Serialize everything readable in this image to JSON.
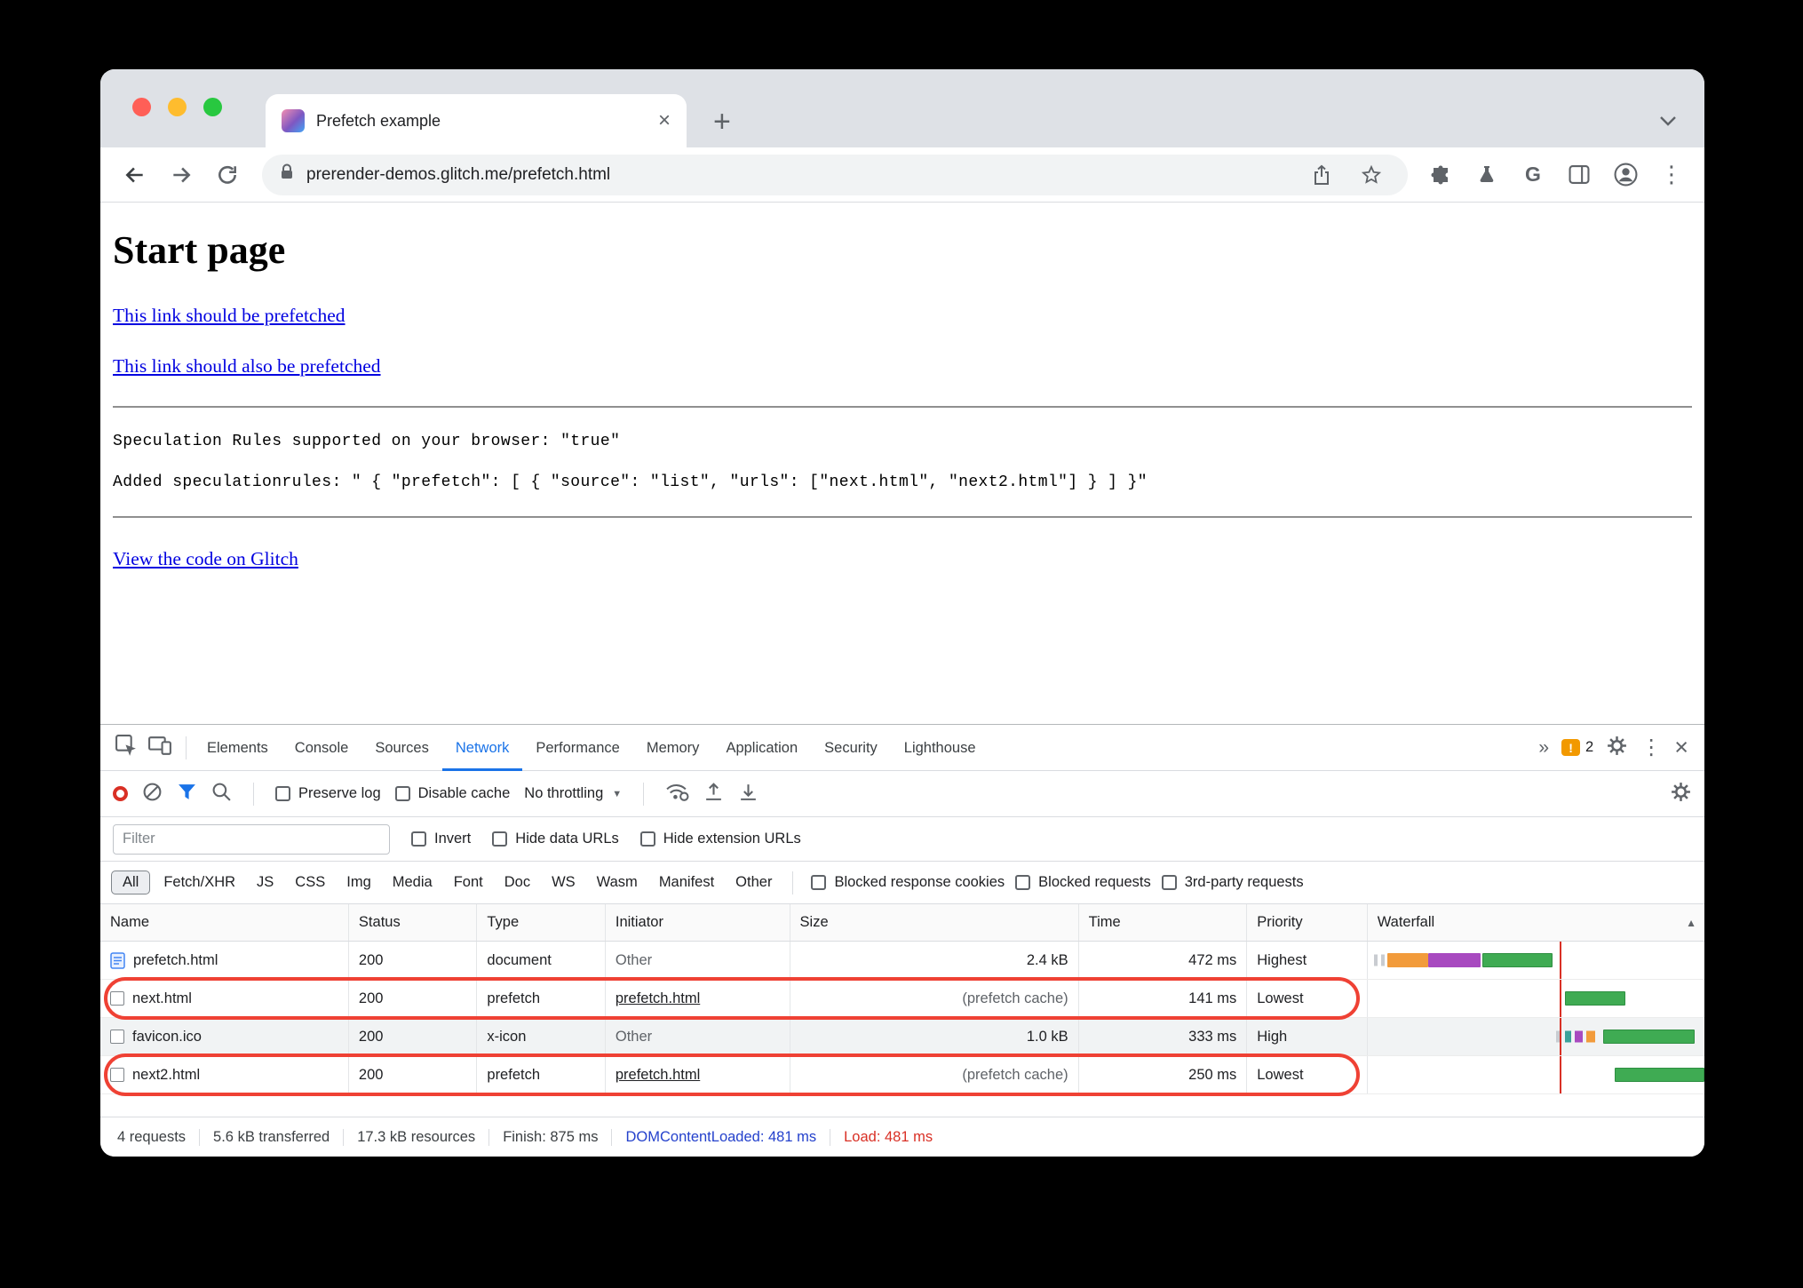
{
  "window": {
    "tab_title": "Prefetch example",
    "url": "prerender-demos.glitch.me/prefetch.html"
  },
  "page": {
    "heading": "Start page",
    "link1": "This link should be prefetched",
    "link2": "This link should also be prefetched",
    "code_line1": "Speculation Rules supported on your browser: \"true\"",
    "code_line2": "Added speculationrules: \" { \"prefetch\": [ { \"source\": \"list\", \"urls\": [\"next.html\", \"next2.html\"] } ] }\"",
    "glitch_link": "View the code on Glitch"
  },
  "devtools": {
    "tabs": [
      "Elements",
      "Console",
      "Sources",
      "Network",
      "Performance",
      "Memory",
      "Application",
      "Security",
      "Lighthouse"
    ],
    "selected_tab": "Network",
    "warning_count": "2",
    "toolbar": {
      "preserve_log": "Preserve log",
      "disable_cache": "Disable cache",
      "throttling": "No throttling"
    },
    "filter": {
      "placeholder": "Filter",
      "invert": "Invert",
      "hide_data_urls": "Hide data URLs",
      "hide_extension_urls": "Hide extension URLs",
      "types": [
        "All",
        "Fetch/XHR",
        "JS",
        "CSS",
        "Img",
        "Media",
        "Font",
        "Doc",
        "WS",
        "Wasm",
        "Manifest",
        "Other"
      ],
      "selected_type": "All",
      "blocked_cookies": "Blocked response cookies",
      "blocked_requests": "Blocked requests",
      "third_party": "3rd-party requests"
    },
    "table": {
      "columns": [
        "Name",
        "Status",
        "Type",
        "Initiator",
        "Size",
        "Time",
        "Priority",
        "Waterfall"
      ],
      "rows": [
        {
          "name": "prefetch.html",
          "status": "200",
          "type": "document",
          "initiator": "Other",
          "size": "2.4 kB",
          "time": "472 ms",
          "priority": "Highest"
        },
        {
          "name": "next.html",
          "status": "200",
          "type": "prefetch",
          "initiator": "prefetch.html",
          "size": "(prefetch cache)",
          "time": "141 ms",
          "priority": "Lowest"
        },
        {
          "name": "favicon.ico",
          "status": "200",
          "type": "x-icon",
          "initiator": "Other",
          "size": "1.0 kB",
          "time": "333 ms",
          "priority": "High"
        },
        {
          "name": "next2.html",
          "status": "200",
          "type": "prefetch",
          "initiator": "prefetch.html",
          "size": "(prefetch cache)",
          "time": "250 ms",
          "priority": "Lowest"
        }
      ]
    },
    "summary": {
      "requests": "4 requests",
      "transferred": "5.6 kB transferred",
      "resources": "17.3 kB resources",
      "finish": "Finish: 875 ms",
      "dcl": "DOMContentLoaded: 481 ms",
      "load": "Load: 481 ms"
    }
  },
  "colors": {
    "accent_blue": "#1a73e8",
    "highlight_red": "#ef4134",
    "load_red": "#d93025",
    "dcl_blue": "#2441cc",
    "waterfall_green": "#3fab53",
    "waterfall_green_dark": "#2f8f42",
    "waterfall_orange": "#f29b3b",
    "waterfall_purple": "#a84ac0",
    "waterfall_teal": "#3aa29a",
    "waterfall_gray": "#c9ccd1",
    "traffic_red": "#ff5f57",
    "traffic_yellow": "#febc2e",
    "traffic_green": "#28c840"
  }
}
